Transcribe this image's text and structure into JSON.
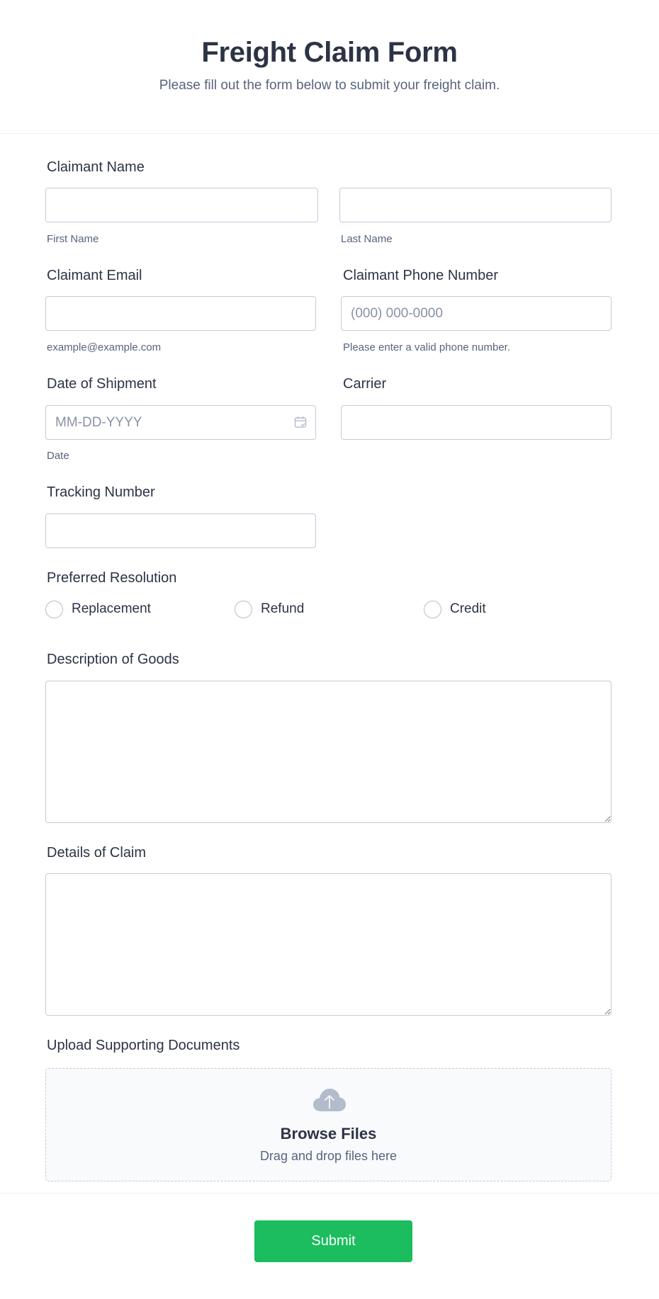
{
  "header": {
    "title": "Freight Claim Form",
    "subtitle": "Please fill out the form below to submit your freight claim."
  },
  "fields": {
    "claimant_name": {
      "label": "Claimant Name",
      "first": {
        "value": "",
        "placeholder": "",
        "sublabel": "First Name"
      },
      "last": {
        "value": "",
        "placeholder": "",
        "sublabel": "Last Name"
      }
    },
    "email": {
      "label": "Claimant Email",
      "value": "",
      "placeholder": "",
      "sublabel": "example@example.com"
    },
    "phone": {
      "label": "Claimant Phone Number",
      "value": "",
      "placeholder": "(000) 000-0000",
      "sublabel": "Please enter a valid phone number."
    },
    "date": {
      "label": "Date of Shipment",
      "value": "",
      "placeholder": "MM-DD-YYYY",
      "sublabel": "Date",
      "icon": "calendar-icon"
    },
    "carrier": {
      "label": "Carrier",
      "value": "",
      "placeholder": ""
    },
    "tracking": {
      "label": "Tracking Number",
      "value": "",
      "placeholder": ""
    },
    "resolution": {
      "label": "Preferred Resolution",
      "options": [
        "Replacement",
        "Refund",
        "Credit"
      ],
      "selected": null
    },
    "description": {
      "label": "Description of Goods",
      "value": ""
    },
    "details": {
      "label": "Details of Claim",
      "value": ""
    },
    "upload": {
      "label": "Upload Supporting Documents",
      "icon": "cloud-upload-icon",
      "browse_label": "Browse Files",
      "drag_text": "Drag and drop files here"
    }
  },
  "submit": {
    "label": "Submit"
  },
  "colors": {
    "accent": "#1bbd5e",
    "text": "#2c3345",
    "muted": "#57647e",
    "border": "#c3cad8"
  }
}
